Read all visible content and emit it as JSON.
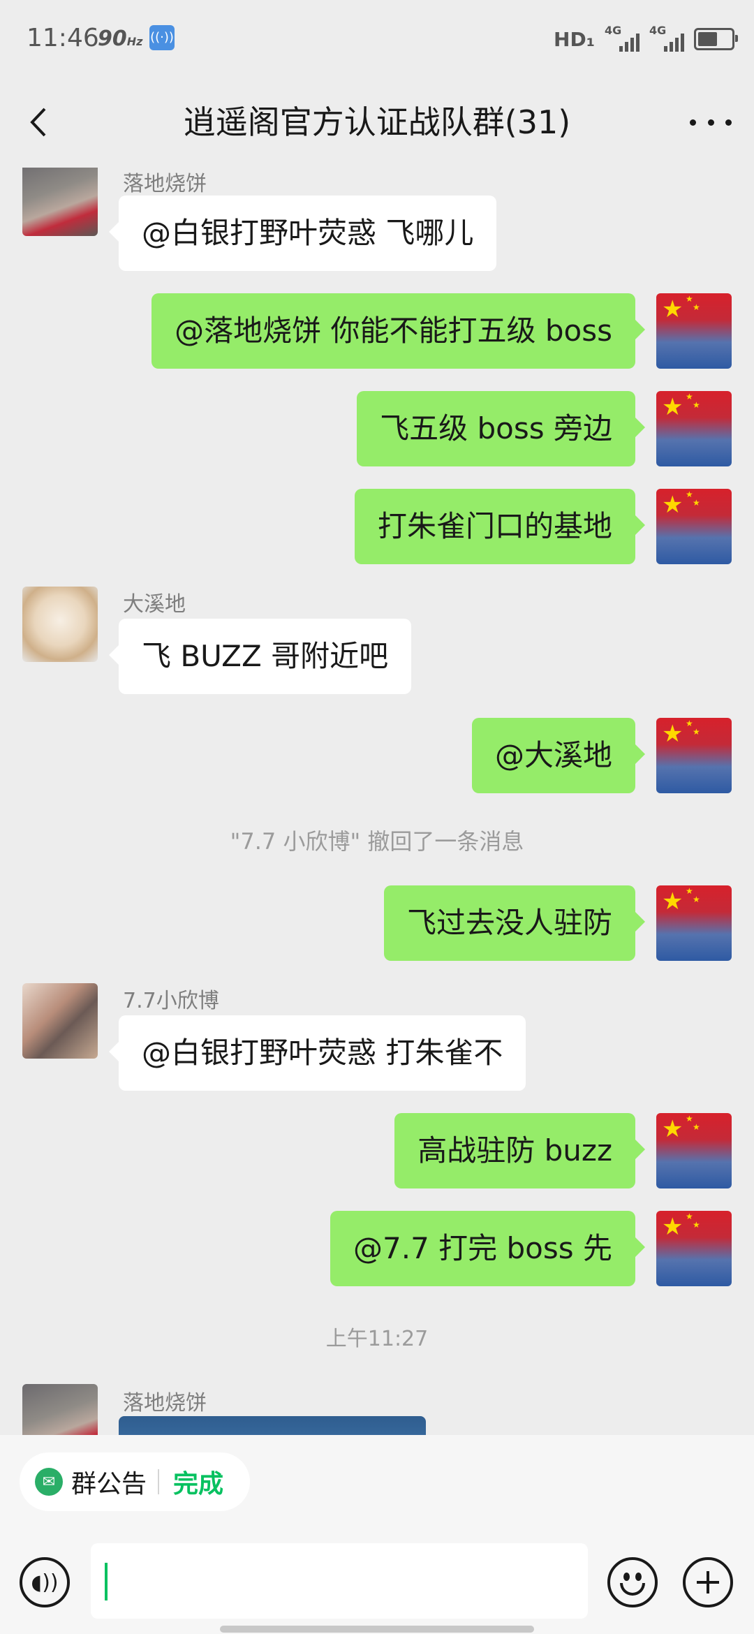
{
  "status_bar": {
    "time": "11:46",
    "refresh_rate": "90",
    "refresh_unit": "Hz",
    "network_label": "HD₁",
    "sim1_tech": "4G",
    "sim2_tech": "4G",
    "battery_level": 0.6
  },
  "nav": {
    "title": "逍遥阁官方认证战队群(31)"
  },
  "senders": {
    "luodi": "落地烧饼",
    "daxidi": "大溪地",
    "xinbo": "7.7小欣博"
  },
  "messages": {
    "m1": "@白银打野叶荧惑  飞哪儿",
    "m2": "@落地烧饼  你能不能打五级 boss",
    "m3": "飞五级 boss 旁边",
    "m4": "打朱雀门口的基地",
    "m5": "飞 BUZZ 哥附近吧",
    "m6": "@大溪地",
    "m7": "飞过去没人驻防",
    "m8": "@白银打野叶荧惑  打朱雀不",
    "m9": "高战驻防 buzz",
    "m10": "@7.7  打完 boss 先"
  },
  "system": {
    "recall": "\"7.7 小欣博\" 撤回了一条消息",
    "timestamp": "上午11:27"
  },
  "bottom": {
    "notice_label": "群公告",
    "notice_done": "完成"
  },
  "colors": {
    "accent": "#07c160",
    "bubble_out": "#95ec69",
    "bubble_in": "#ffffff",
    "background": "#ededed"
  }
}
